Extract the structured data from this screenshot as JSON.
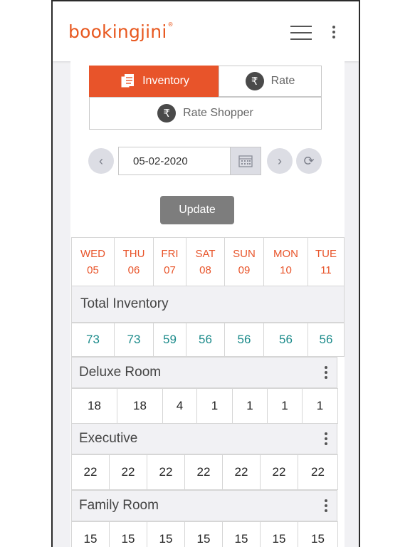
{
  "brand": {
    "name_part1": "bookin",
    "name_glyph": "g",
    "name_part2": "jini",
    "reg": "®",
    "color": "#e8581f"
  },
  "tabs": {
    "inventory": "Inventory",
    "rate": "Rate",
    "rate_shopper": "Rate Shopper",
    "rupee_symbol": "₹"
  },
  "date_picker": {
    "value": "05-02-2020",
    "prev": "‹",
    "next": "›",
    "refresh": "⟳"
  },
  "update_label": "Update",
  "days": [
    {
      "dow": "WED",
      "day": "05"
    },
    {
      "dow": "THU",
      "day": "06"
    },
    {
      "dow": "FRI",
      "day": "07"
    },
    {
      "dow": "SAT",
      "day": "08"
    },
    {
      "dow": "SUN",
      "day": "09"
    },
    {
      "dow": "MON",
      "day": "10"
    },
    {
      "dow": "TUE",
      "day": "11"
    }
  ],
  "total_inventory": {
    "label": "Total Inventory",
    "values": [
      "73",
      "73",
      "59",
      "56",
      "56",
      "56",
      "56"
    ]
  },
  "rooms": [
    {
      "name": "Deluxe Room",
      "values": [
        "18",
        "18",
        "4",
        "1",
        "1",
        "1",
        "1"
      ]
    },
    {
      "name": "Executive",
      "values": [
        "22",
        "22",
        "22",
        "22",
        "22",
        "22",
        "22"
      ]
    },
    {
      "name": "Family Room",
      "values": [
        "15",
        "15",
        "15",
        "15",
        "15",
        "15",
        "15"
      ]
    }
  ],
  "colors": {
    "accent": "#e8542a",
    "teal": "#1c8b8b"
  }
}
